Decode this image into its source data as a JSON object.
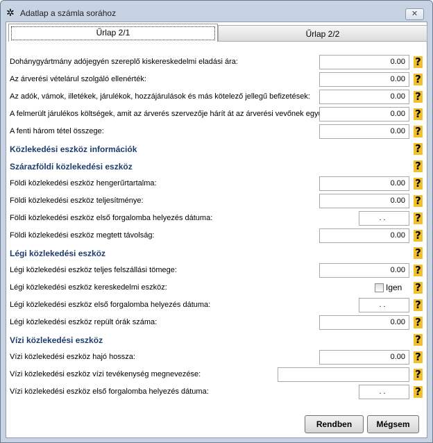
{
  "window": {
    "title": "Adatlap  a számla sorához",
    "close": "✕"
  },
  "tabs": [
    {
      "label": "Űrlap 2/1"
    },
    {
      "label": "Űrlap 2/2"
    }
  ],
  "rows": [
    {
      "type": "num",
      "label": "Dohánygyártmány adójegyén szereplő kiskereskedelmi eladási ára:",
      "value": "0.00"
    },
    {
      "type": "num",
      "label": "Az árverési vételárul szolgáló ellenérték:",
      "value": "0.00"
    },
    {
      "type": "num",
      "label": "Az adók, vámok, illetékek, járulékok, hozzájárulások és más kötelező jellegű befizetések:",
      "value": "0.00"
    },
    {
      "type": "num",
      "label": "A felmerült járulékos költségek, amit az árverés szervezője hárít át az árverési vevőnek együtte",
      "value": "0.00"
    },
    {
      "type": "num",
      "label": "A fenti három tétel összege:",
      "value": "0.00"
    },
    {
      "type": "section",
      "label": "Közlekedési eszköz információk"
    },
    {
      "type": "section",
      "label": "Szárazföldi közlekedési eszköz"
    },
    {
      "type": "num",
      "label": "Földi közlekedési eszköz hengerűrtartalma:",
      "value": "0.00"
    },
    {
      "type": "num",
      "label": "Földi közlekedési eszköz teljesítménye:",
      "value": "0.00"
    },
    {
      "type": "date",
      "label": "Földi közlekedési eszköz első forgalomba helyezés dátuma:",
      "value": ". ."
    },
    {
      "type": "num",
      "label": "Földi közlekedési eszköz megtett távolság:",
      "value": "0.00"
    },
    {
      "type": "section",
      "label": "Légi közlekedési eszköz"
    },
    {
      "type": "num",
      "label": "Légi közlekedési eszköz teljes felszállási tömege:",
      "value": "0.00"
    },
    {
      "type": "check",
      "label": "Légi közlekedési eszköz kereskedelmi eszköz:",
      "value": "Igen",
      "checked": false
    },
    {
      "type": "date",
      "label": "Légi közlekedési eszköz első forgalomba helyezés dátuma:",
      "value": ". ."
    },
    {
      "type": "num",
      "label": "Légi közlekedési eszköz repült órák száma:",
      "value": "0.00"
    },
    {
      "type": "section",
      "label": "Vízi közlekedési eszköz"
    },
    {
      "type": "num",
      "label": "Vízi közlekedési eszköz hajó hossza:",
      "value": "0.00"
    },
    {
      "type": "text",
      "label": "Vízi közlekedési eszköz vízi tevékenység megnevezése:",
      "value": ""
    },
    {
      "type": "date",
      "label": "Vízi közlekedési eszköz első forgalomba helyezés dátuma:",
      "value": ". ."
    }
  ],
  "help_icon": "question-mark-icon",
  "help_glyph": "?",
  "buttons": {
    "ok": "Rendben",
    "cancel": "Mégsem"
  }
}
